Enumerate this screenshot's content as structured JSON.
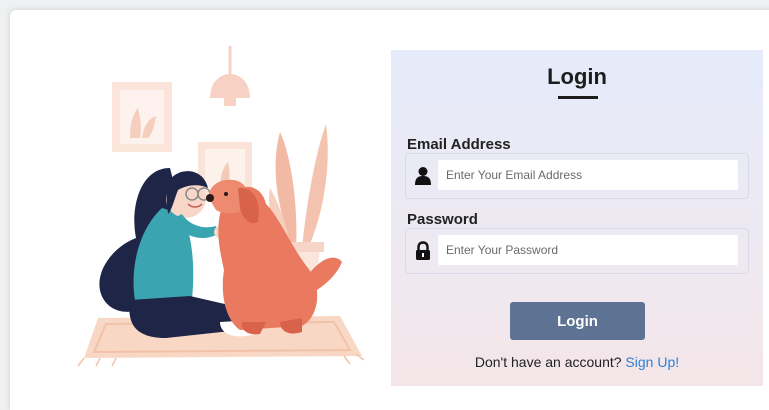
{
  "form": {
    "title": "Login",
    "email": {
      "label": "Email Address",
      "placeholder": "Enter Your Email Address",
      "value": ""
    },
    "password": {
      "label": "Password",
      "placeholder": "Enter Your Password",
      "value": ""
    },
    "submit_label": "Login",
    "signup_prompt": "Don't have an account?",
    "signup_link": "Sign Up!"
  },
  "colors": {
    "button": "#5e7394",
    "link": "#2e7fd6",
    "panel_top": "#e5ebfa",
    "panel_bottom": "#f4e6e8"
  },
  "icons": {
    "email": "user-icon",
    "password": "lock-icon"
  }
}
